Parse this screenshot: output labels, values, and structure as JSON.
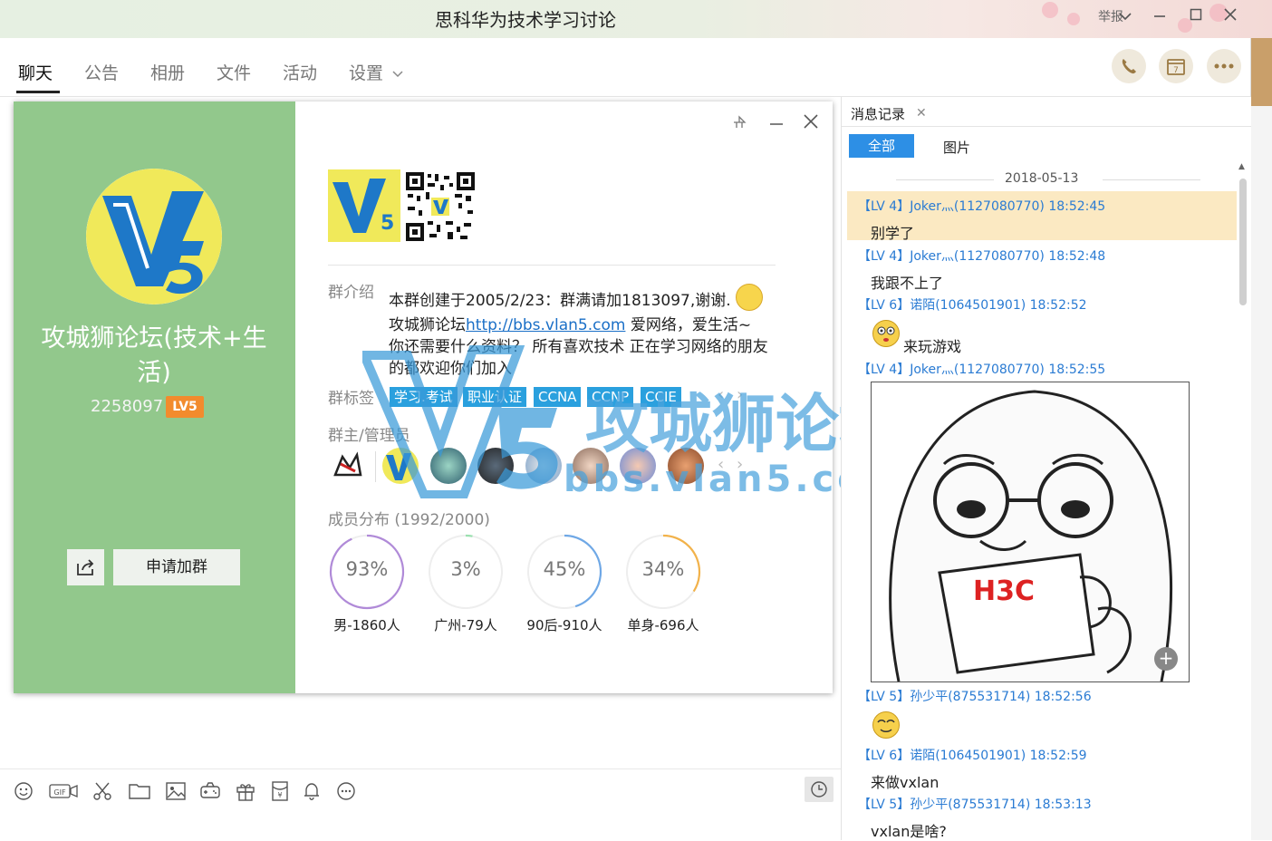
{
  "window": {
    "title": "思科华为技术学习讨论",
    "report_label": "举报"
  },
  "tabs": [
    {
      "label": "聊天",
      "active": true
    },
    {
      "label": "公告"
    },
    {
      "label": "相册"
    },
    {
      "label": "文件"
    },
    {
      "label": "活动"
    },
    {
      "label": "设置"
    }
  ],
  "top_actions": {
    "calendar_day": "7"
  },
  "group_card": {
    "name": "攻城狮论坛(技术+生活)",
    "id": "2258097",
    "level": "LV5",
    "join_label": "申请加群",
    "intro_label": "群介绍",
    "intro_line1": "本群创建于2005/2/23：群满请加1813097,谢谢.",
    "intro_line2_prefix": "攻城狮论坛",
    "intro_link": "http://bbs.vlan5.com",
    "intro_line2_suffix": " 爱网络，爱生活~",
    "intro_line3": "你还需要什么资料？ 所有喜欢技术 正在学习网络的朋友的都欢迎你们加入",
    "tags_label": "群标签",
    "tags": [
      "学习.考试",
      "职业认证",
      "CCNA",
      "CCNP",
      "CCIE"
    ],
    "admins_label": "群主/管理员",
    "members_label": "成员分布 (1992/2000)",
    "stats": [
      {
        "percent": "93%",
        "value": 0.93,
        "caption": "男-1860人",
        "color": "#b08ad8"
      },
      {
        "percent": "3%",
        "value": 0.03,
        "caption": "广州-79人",
        "color": "#9be0b0"
      },
      {
        "percent": "45%",
        "value": 0.45,
        "caption": "90后-910人",
        "color": "#6fa8e6"
      },
      {
        "percent": "34%",
        "value": 0.34,
        "caption": "单身-696人",
        "color": "#f2b24a"
      }
    ]
  },
  "watermark": {
    "text": "攻城狮论坛",
    "url": "bbs.vlan5.com"
  },
  "panel": {
    "tab_label": "消息记录",
    "filter_all": "全部",
    "filter_images": "图片",
    "date": "2018-05-13",
    "messages": [
      {
        "head": "【LV 4】Joker灬(1127080770) 18:52:45",
        "text": "别学了"
      },
      {
        "head": "【LV 4】Joker灬(1127080770) 18:52:48",
        "text": "我跟不上了"
      },
      {
        "head": "【LV 6】诺陌(1064501901) 18:52:52",
        "text": "来玩游戏"
      },
      {
        "head": "【LV 4】Joker灬(1127080770) 18:52:55",
        "text": ""
      },
      {
        "head": "【LV 5】孙少平(875531714) 18:52:56",
        "text": ""
      },
      {
        "head": "【LV 6】诺陌(1064501901) 18:52:59",
        "text": "来做vxlan"
      },
      {
        "head": "【LV 5】孙少平(875531714) 18:53:13",
        "text": "vxlan是啥?"
      }
    ],
    "meme_cup_text": "H3C"
  }
}
